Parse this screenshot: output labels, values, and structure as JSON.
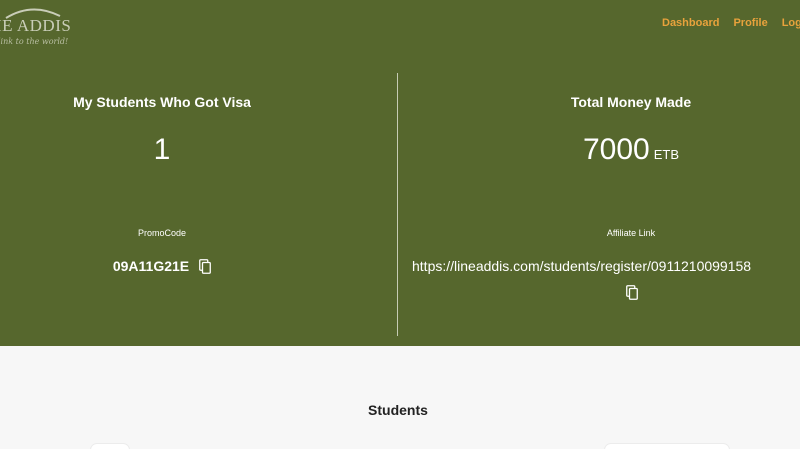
{
  "brand": {
    "name": "IE ADDIS",
    "tagline": "link to the world!"
  },
  "nav": {
    "items": [
      "Dashboard",
      "Profile",
      "Log Out"
    ]
  },
  "stats": {
    "visa": {
      "title": "My Students Who Got Visa",
      "value": "1"
    },
    "money": {
      "title": "Total Money Made",
      "value": "7000",
      "unit": "ETB"
    }
  },
  "promo": {
    "label": "PromoCode",
    "code": "09A11G21E"
  },
  "affiliate": {
    "label": "Affiliate Link",
    "url": "https://lineaddis.com/students/register/0911210099158"
  },
  "students": {
    "title": "Students"
  },
  "colors": {
    "hero": "#56672d",
    "nav": "#e8a23c",
    "page": "#f7f7f7"
  },
  "icons": [
    "copy-icon",
    "copy-icon"
  ]
}
